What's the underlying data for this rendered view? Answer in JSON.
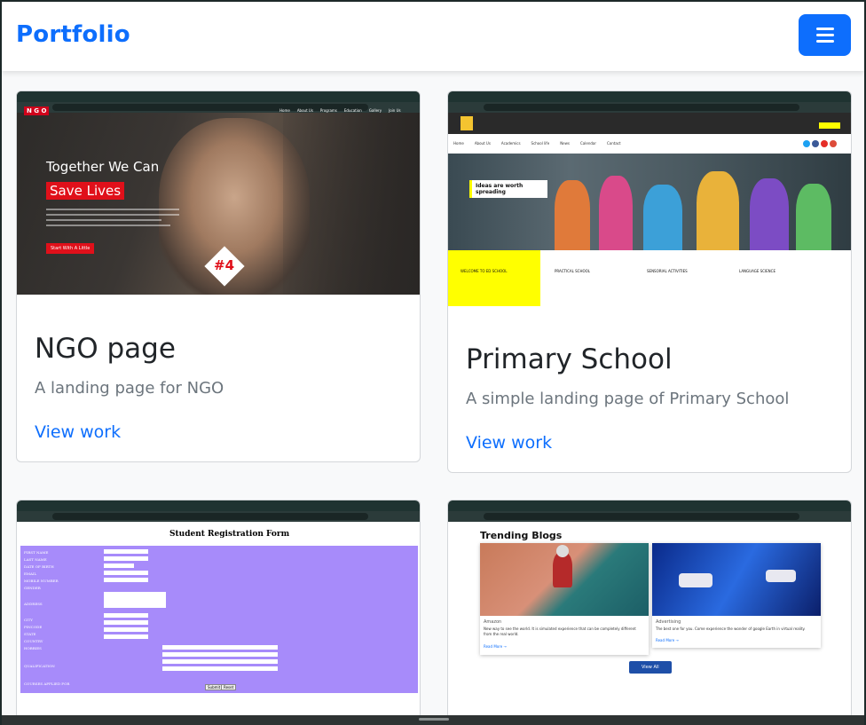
{
  "navbar": {
    "brand": "Portfolio"
  },
  "cards": [
    {
      "title": "NGO page",
      "text": "A landing page for NGO",
      "link": "View work",
      "shot": {
        "logo": "N G O",
        "nav": [
          "Home",
          "About Us",
          "Programs",
          "Education",
          "Gallery",
          "Join Us"
        ],
        "headline1": "Together We Can",
        "headline2": "Save Lives",
        "cta": "Start With A Little",
        "badge": "#4"
      }
    },
    {
      "title": "Primary School",
      "text": "A simple landing page of Primary School",
      "link": "View work",
      "shot": {
        "nav": [
          "Home",
          "About Us",
          "Academics",
          "School life",
          "News",
          "Calendar",
          "Contact"
        ],
        "banner": "Ideas are worth spreading",
        "features": [
          "WELCOME TO ED SCHOOL",
          "PRACTICAL SCHOOL",
          "SENSORIAL ACTIVITIES",
          "LANGUAGE SCIENCE"
        ]
      }
    },
    {
      "title": "Student Registration Form",
      "text": "",
      "link": "",
      "shot": {
        "heading": "Student Registration Form",
        "fields": [
          "FIRST NAME",
          "LAST NAME",
          "DATE OF BIRTH",
          "EMAIL",
          "MOBILE NUMBER",
          "GENDER",
          "ADDRESS",
          "CITY",
          "PINCODE",
          "STATE",
          "COUNTRY",
          "HOBBIES",
          "QUALIFICATION",
          "COURSES APPLIED FOR"
        ],
        "buttons": [
          "Submit",
          "Reset"
        ]
      }
    },
    {
      "title": "Trending Blogs",
      "text": "",
      "link": "",
      "shot": {
        "heading": "Trending Blogs",
        "posts": [
          {
            "tag": "Amazon",
            "body": "New way to see the world. It is simulated experience that can be completely different from the real world.",
            "more": "Read More →"
          },
          {
            "tag": "Advertising",
            "body": "The best one for you. Come experience the wonder of google Earth in virtual reality.",
            "more": "Read More →"
          }
        ],
        "button": "View All"
      }
    }
  ],
  "colors": {
    "primary": "#0d6efd",
    "muted": "#6c757d",
    "form_purple": "#a78bfa"
  }
}
